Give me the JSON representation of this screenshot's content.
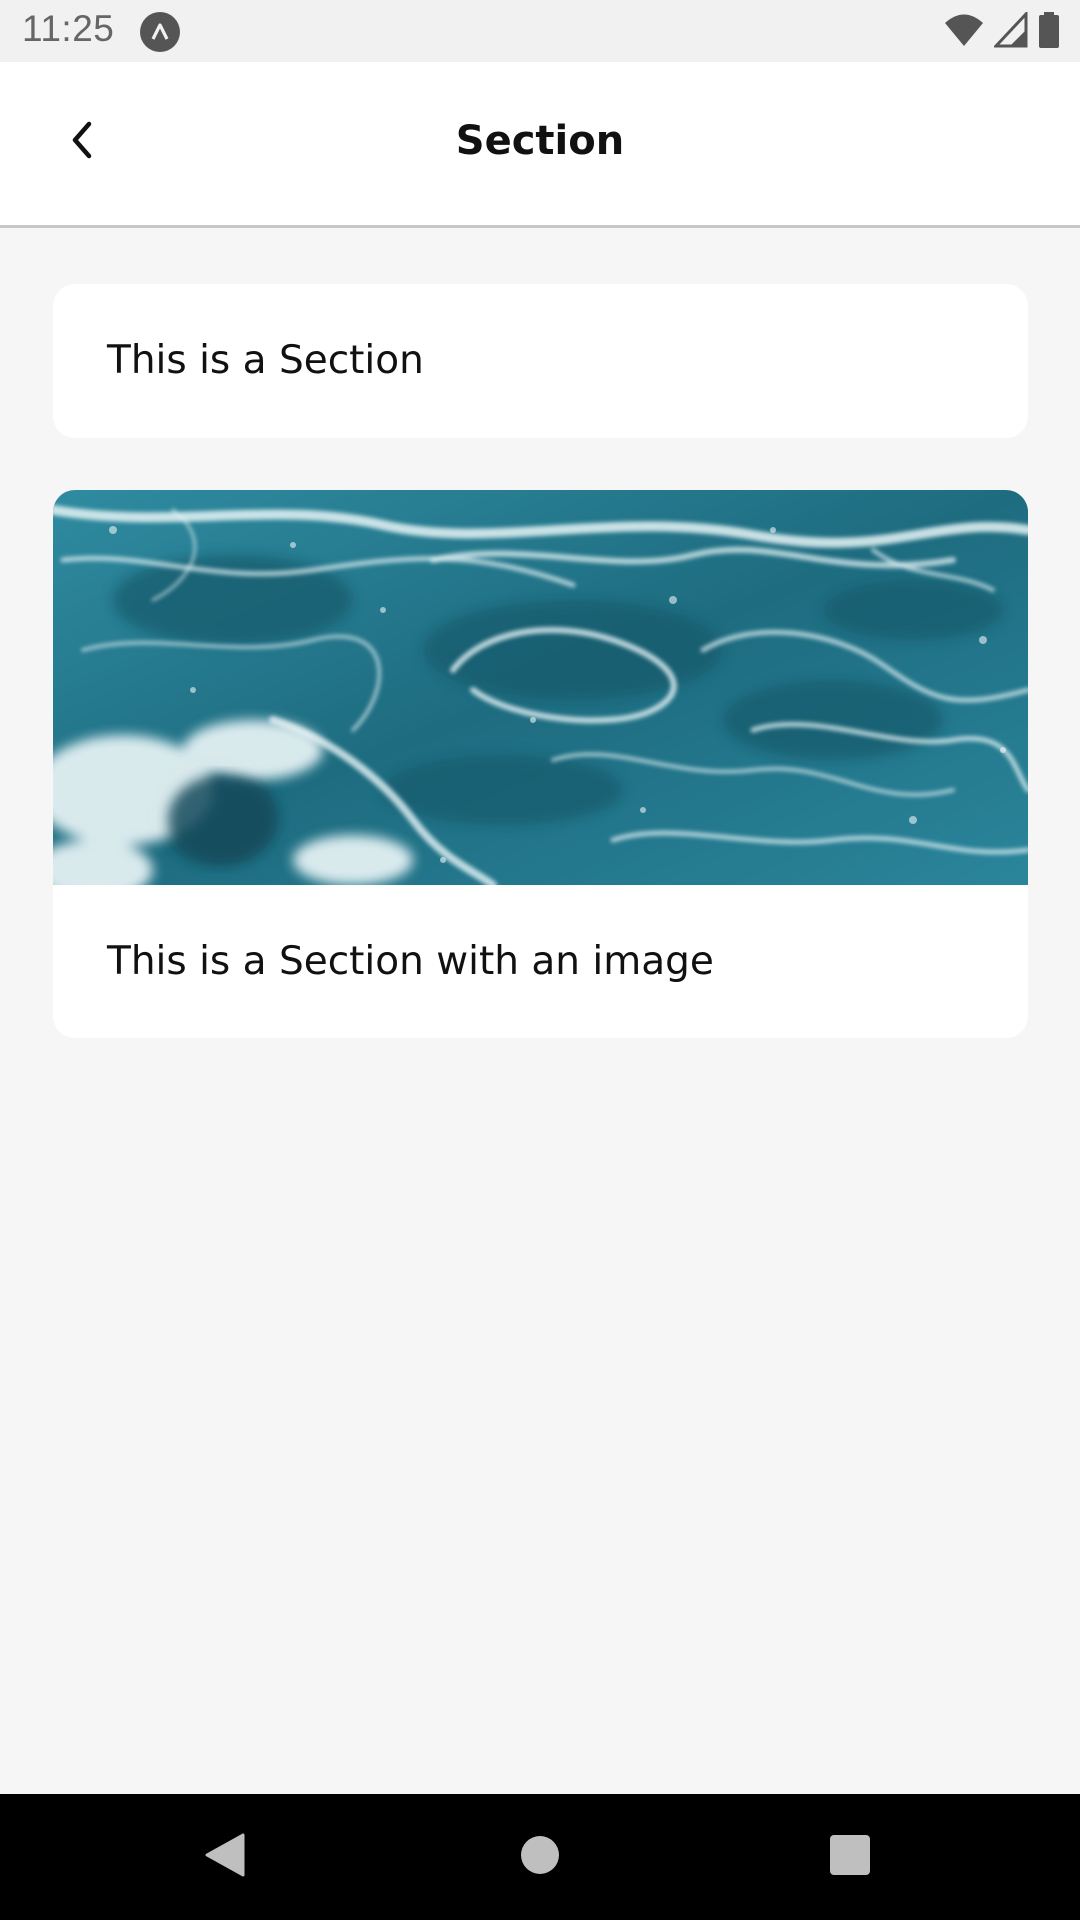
{
  "status_bar": {
    "time": "11:25",
    "app_icon": "react-native-logo-icon",
    "wifi_icon": "wifi-icon",
    "signal_icon": "cell-signal-icon",
    "battery_icon": "battery-icon"
  },
  "header": {
    "title": "Section",
    "back_icon": "chevron-left-icon"
  },
  "sections": [
    {
      "text": "This is a Section"
    },
    {
      "text": "This is a Section with an image",
      "image": "ocean-waves"
    }
  ],
  "nav_bar": {
    "back_icon": "nav-back-icon",
    "home_icon": "nav-home-icon",
    "recents_icon": "nav-recents-icon"
  },
  "colors": {
    "background": "#f6f6f6",
    "card": "#ffffff",
    "ocean_dark": "#1f6b7e",
    "ocean_light": "#3b93a8"
  }
}
